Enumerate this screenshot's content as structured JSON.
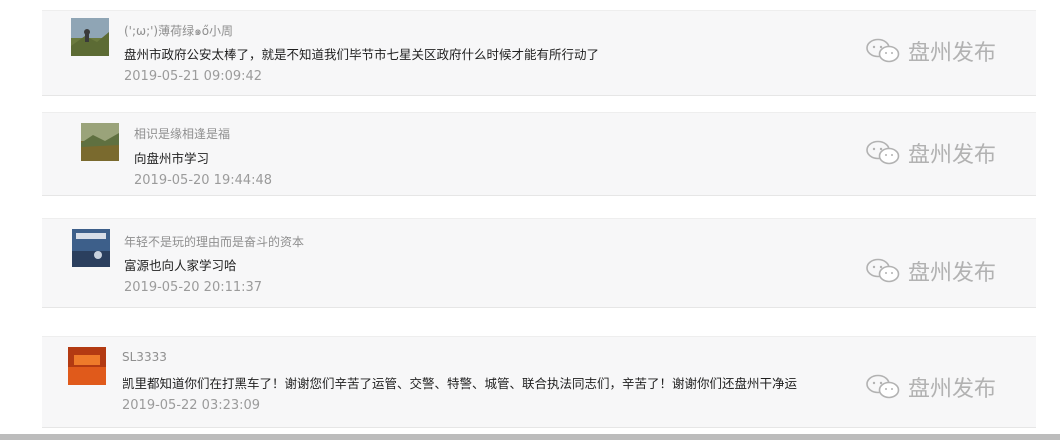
{
  "watermark": "盘州发布",
  "comments": [
    {
      "user": "(';ω;')薄荷绿๑ő小周",
      "text": "盘州市政府公安太棒了，就是不知道我们毕节市七星关区政府什么时候才能有所行动了",
      "time": "2019-05-21 09:09:42",
      "avatar_icon": "cyclist-photo-icon"
    },
    {
      "user": "相识是缘相逢是福",
      "text": "向盘州市学习",
      "time": "2019-05-20 19:44:48",
      "avatar_icon": "landscape-photo-icon"
    },
    {
      "user": "年轻不是玩的理由而是奋斗的资本",
      "text": "富源也向人家学习哈",
      "time": "2019-05-20 20:11:37",
      "avatar_icon": "sky-photo-icon"
    },
    {
      "user": "SL3333",
      "text": "凯里都知道你们在打黑车了！谢谢您们辛苦了运管、交警、特警、城管、联合执法同志们，辛苦了！谢谢你们还盘州干净运",
      "time": "2019-05-22 03:23:09",
      "avatar_icon": "orange-photo-icon"
    }
  ]
}
